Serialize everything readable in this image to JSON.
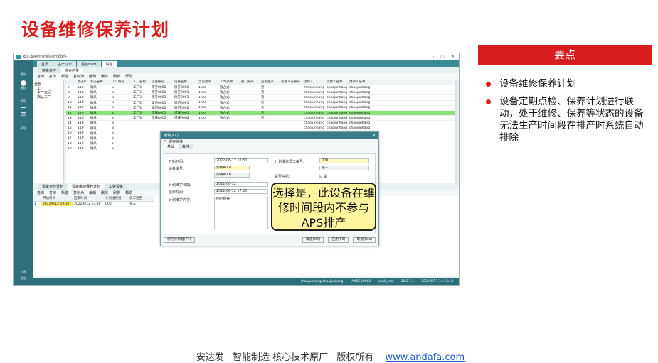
{
  "slide_title": "设备维修保养计划",
  "key_points": {
    "header": "要点",
    "items": [
      "设备维修保养计划",
      "设备定期点检、保养计划进行联动，处于维修、保养等状态的设备无法生产时间段在排产时系统自动排除"
    ]
  },
  "footer": {
    "company": "安达发",
    "slogan": "智能制造 核心技术原厂",
    "rights": "版权所有",
    "url": "www.andafa.com"
  },
  "app": {
    "title": "安达发AX智能制造管理软件",
    "window_buttons": [
      "-",
      "□",
      "✕"
    ],
    "nav_items": [
      {
        "label": "模块",
        "icon": "grid-icon"
      },
      {
        "label": "基础",
        "icon": "circle-icon"
      },
      {
        "label": "常用",
        "icon": "star-icon"
      },
      {
        "label": "消息",
        "icon": "chat-icon"
      },
      {
        "label": "帮助",
        "icon": "help-icon"
      }
    ],
    "nav_bottom": [
      "工具",
      "退出"
    ],
    "tabs": [
      "首页",
      "生产订单",
      "超级BOM",
      "设备"
    ],
    "active_tab": 3,
    "subtabs": [
      "搜索条件",
      "搜索结果"
    ],
    "toolbar": [
      "查询",
      "打印",
      "新建",
      "复制为",
      "编辑",
      "删除",
      "刷新",
      "帮助"
    ],
    "tree": [
      "全部",
      "工厂",
      "生产车间",
      "默认工厂"
    ],
    "grid_headers": [
      "",
      "状态ID",
      "状态名称",
      "工厂编号",
      "工厂名称",
      "设备编号",
      "设备名称",
      "当前效率",
      "工时来源",
      "部门编号",
      "是否生产",
      "设备人员编号",
      "创建人",
      "创建人名称",
      "更新人名称"
    ],
    "grid_rows": [
      [
        "7",
        "110",
        "确认",
        "3",
        "工厂3",
        "债券0002",
        "债券0002",
        "1.00",
        "独占式",
        "",
        "否",
        "",
        "chaojunhang",
        "chaojunhang",
        "chaojunhang"
      ],
      [
        "8",
        "110",
        "确认",
        "3",
        "工厂3",
        "债券0001",
        "债券0001",
        "1.00",
        "独占式",
        "",
        "否",
        "",
        "chaojunhang",
        "chaojunhang",
        "chaojunhang"
      ],
      [
        "9",
        "110",
        "确认",
        "3",
        "工厂3",
        "债券0003",
        "债券0003",
        "1.00",
        "独占式",
        "",
        "否",
        "",
        "chaojunhang",
        "chaojunhang",
        "chaojunhang"
      ],
      [
        "10",
        "110",
        "确认",
        "3",
        "工厂3",
        "锯切0001",
        "锯切0001",
        "1.00",
        "独占式",
        "",
        "否",
        "",
        "chaojunhang",
        "chaojunhang",
        "chaojunhang"
      ],
      [
        "11",
        "110",
        "确认",
        "3",
        "工厂3",
        "锯切0002",
        "锯切0002",
        "1.00",
        "独占式",
        "",
        "否",
        "",
        "chaojunhang",
        "chaojunhang",
        "chaojunhang"
      ],
      [
        "12",
        "110",
        "确认",
        "3",
        "工厂3",
        "焊线A001",
        "焊线A001",
        "1.00",
        "独占式",
        "",
        "否",
        "",
        "chaojunhang",
        "chaojunhang",
        "chaojunhang"
      ],
      [
        "13",
        "110",
        "确认",
        "3",
        "工厂3",
        "焊线A002",
        "焊线A002",
        "1.00",
        "独占式",
        "",
        "否",
        "",
        "chaojunhang",
        "chaojunhang",
        "chaojunhang"
      ],
      [
        "14",
        "110",
        "确认",
        "3",
        "",
        "",
        "",
        "",
        "",
        "",
        "",
        "",
        "chaojunhang",
        "chaojunhang",
        "chaojunhang"
      ],
      [
        "15",
        "110",
        "确认",
        "3",
        "",
        "",
        "",
        "",
        "",
        "",
        "",
        "",
        "chaojunhang",
        "chaojunhang",
        "chaojunhang"
      ],
      [
        "16",
        "110",
        "确认",
        "5",
        "",
        "",
        "",
        "",
        "",
        "",
        "",
        "",
        "sunyangping",
        "sunyangping",
        "sunyangping"
      ],
      [
        "17",
        "110",
        "确认",
        "5",
        "",
        "",
        "",
        "",
        "",
        "",
        "",
        "",
        "sunyangping",
        "sunyangping",
        "sunyangping"
      ],
      [
        "18",
        "110",
        "确认",
        "5",
        "",
        "",
        "",
        "",
        "",
        "",
        "",
        "",
        "sunyangping",
        "sunyangping",
        "sunyangping"
      ],
      [
        "19",
        "110",
        "确认",
        "5",
        "",
        "",
        "",
        "",
        "",
        "",
        "",
        "",
        "sunyangping",
        "sunyangping",
        "sunyangping"
      ]
    ],
    "selected_row": 5,
    "lower_tabs": [
      "设备点检计划",
      "设备维护保养计划",
      "工装设备"
    ],
    "lower_toolbar": [
      "查询",
      "打印",
      "新建",
      "复制为",
      "编辑",
      "删除",
      "刷新",
      "帮助"
    ],
    "lower_headers": [
      "",
      "开始时间",
      "结束时间",
      "计划维修员",
      "员工姓名"
    ],
    "lower_row": [
      "1",
      "2022/6/12 10:30",
      "2022/6/12 17:30",
      "000",
      "张三"
    ],
    "status": [
      "chaojunhang(chaojunhang)",
      "AXDEV0002",
      "audit_test",
      "10.2.7.1",
      "2022/6/13 14:12:13"
    ]
  },
  "dialog": {
    "title": "编辑(AX)",
    "bar_label": "保存继续",
    "tabs": [
      "基础",
      "备注"
    ],
    "start_label": "开始时间:",
    "start_value": "2022-06-12 10:30",
    "device_label": "设备编号:",
    "device_value": "焊线A001",
    "device_name": "焊线A001",
    "plan_date_label": "计划维护日期:",
    "plan_date_value": "2022-06-12",
    "end_label": "结束时间:",
    "end_value": "2022-06-12 17:30",
    "content_label": "计划维护内容:",
    "content_value": "例行保养",
    "staff_label": "计划维修员工编号:",
    "staff_value": "000",
    "staff_name": "张三",
    "stop_label": "是否停机:",
    "stop_value": "是",
    "btn_saveas": "保存并新建(F7)",
    "btn_ok": "确定(OK)",
    "btn_apply": "应用(F9)",
    "btn_cancel": "取消(Esc)"
  },
  "callout": "选择是，此设备在维修时间段内不参与APS排产",
  "colors": {
    "brand_red": "#d81e1e",
    "teal": "#2d6f7a",
    "highlight": "#8fe07f"
  }
}
